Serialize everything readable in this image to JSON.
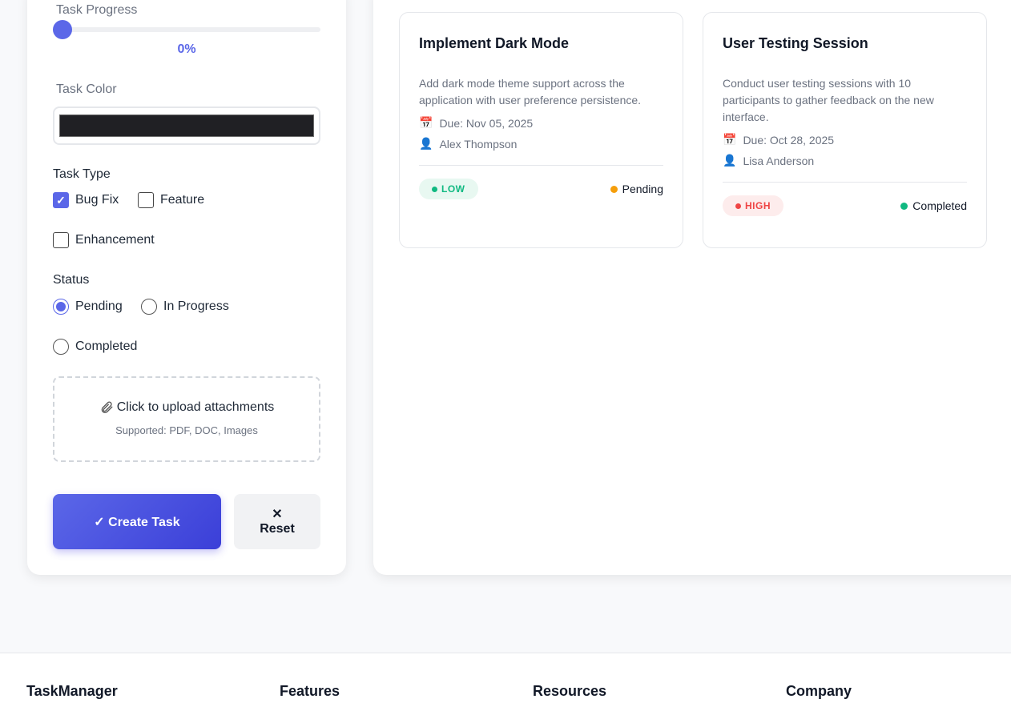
{
  "form": {
    "progress_label": "Task Progress",
    "progress_value": 0,
    "progress_display": "0%",
    "color_label": "Task Color",
    "color_value": "#202024",
    "type_label": "Task Type",
    "types": [
      {
        "label": "Bug Fix",
        "checked": true
      },
      {
        "label": "Feature",
        "checked": false
      },
      {
        "label": "Enhancement",
        "checked": false
      }
    ],
    "status_label": "Status",
    "statuses": [
      {
        "label": "Pending",
        "checked": true
      },
      {
        "label": "In Progress",
        "checked": false
      },
      {
        "label": "Completed",
        "checked": false
      }
    ],
    "upload_icon": "paperclip-icon",
    "upload_text": "Click to upload attachments",
    "upload_hint": "Supported: PDF, DOC, Images",
    "create_label": "✓ Create Task",
    "reset_icon": "✕",
    "reset_label": "Reset"
  },
  "tasks": [
    {
      "title": "Implement Dark Mode",
      "description": "Add dark mode theme support across the application with user preference persistence.",
      "due": "Due: Nov 05, 2025",
      "assignee": "Alex Thompson",
      "priority": "LOW",
      "priority_color": "#10b981",
      "priority_bg": "#e8f8f1",
      "status": "Pending",
      "status_color": "#f59e0b"
    },
    {
      "title": "User Testing Session",
      "description": "Conduct user testing sessions with 10 participants to gather feedback on the new interface.",
      "due": "Due: Oct 28, 2025",
      "assignee": "Lisa Anderson",
      "priority": "HIGH",
      "priority_color": "#ef4444",
      "priority_bg": "#fdecec",
      "status": "Completed",
      "status_color": "#10b981"
    }
  ],
  "footer": {
    "brand": "TaskManager",
    "col1": "Features",
    "col2": "Resources",
    "col3": "Company"
  }
}
